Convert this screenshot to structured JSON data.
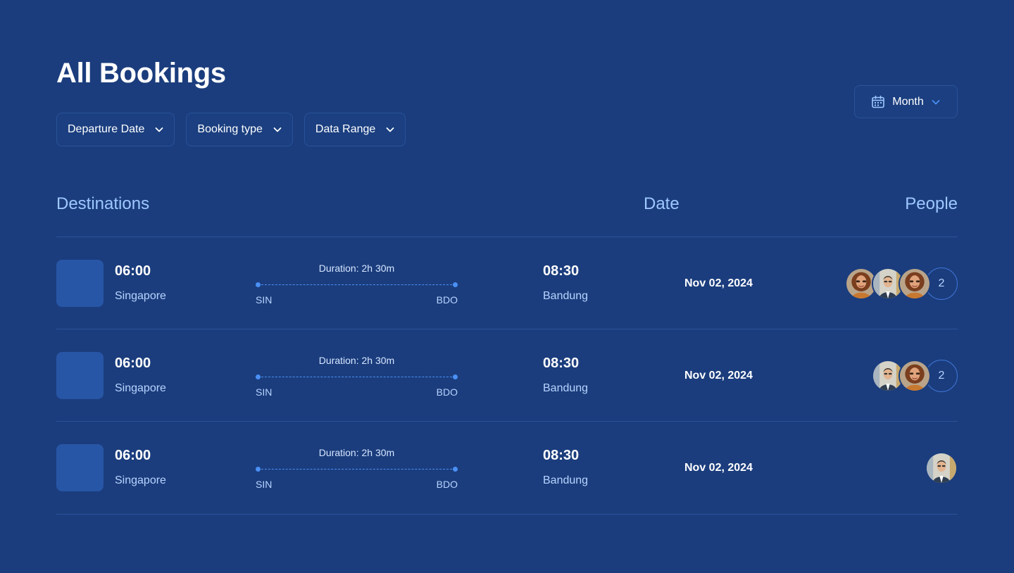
{
  "header": {
    "title": "All Bookings"
  },
  "filters": [
    {
      "label": "Departure Date"
    },
    {
      "label": "Booking type"
    },
    {
      "label": "Data Range"
    }
  ],
  "period_select": {
    "label": "Month"
  },
  "columns": {
    "destinations": "Destinations",
    "date": "Date",
    "people": "People"
  },
  "bookings": [
    {
      "departure_time": "06:00",
      "departure_city": "Singapore",
      "duration": "Duration: 2h 30m",
      "from_code": "SIN",
      "to_code": "BDO",
      "arrival_time": "08:30",
      "arrival_city": "Bandung",
      "date": "Nov 02, 2024",
      "avatars": [
        "woman-avatar",
        "man-avatar",
        "woman-avatar"
      ],
      "extra_count": "2"
    },
    {
      "departure_time": "06:00",
      "departure_city": "Singapore",
      "duration": "Duration: 2h 30m",
      "from_code": "SIN",
      "to_code": "BDO",
      "arrival_time": "08:30",
      "arrival_city": "Bandung",
      "date": "Nov 02, 2024",
      "avatars": [
        "man-avatar",
        "woman-avatar"
      ],
      "extra_count": "2"
    },
    {
      "departure_time": "06:00",
      "departure_city": "Singapore",
      "duration": "Duration: 2h 30m",
      "from_code": "SIN",
      "to_code": "BDO",
      "arrival_time": "08:30",
      "arrival_city": "Bandung",
      "date": "Nov 02, 2024",
      "avatars": [
        "man-avatar"
      ],
      "extra_count": ""
    }
  ],
  "colors": {
    "background": "#1b3d7d",
    "accent": "#4a90f5",
    "header_text": "#9ec8ff",
    "thumbnail": "#2856a6"
  }
}
